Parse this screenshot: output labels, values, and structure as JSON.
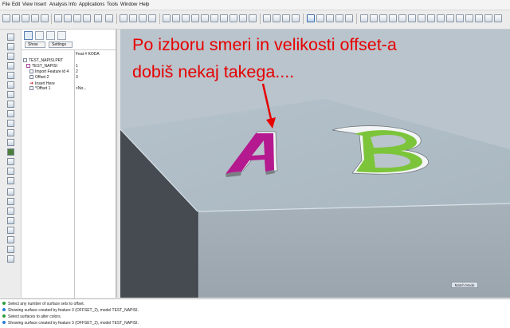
{
  "menubar": {
    "items": [
      "File",
      "Edit",
      "View",
      "Insert",
      "Analysis",
      "Info",
      "Applications",
      "Tools",
      "Window",
      "Help"
    ]
  },
  "navigator": {
    "show_label": "Show",
    "settings_label": "Settings"
  },
  "model_tree": {
    "column_header": "Feat # KODA",
    "rows": [
      {
        "name": "TEST_NAPISI.PRT",
        "value": ""
      },
      {
        "name": "TEST_NAPISI",
        "value": "1"
      },
      {
        "name": "Import Feature id 4",
        "value": "2"
      },
      {
        "name": "Offset 2",
        "value": "3"
      },
      {
        "name": "Insert Here",
        "value": ""
      },
      {
        "name": "*Offset 1",
        "value": "<No..."
      }
    ]
  },
  "annotation": {
    "line1": "Po izboru smeri in velikosti offset-a",
    "line2": "dobiš nekaj takega....",
    "color": "#e60000"
  },
  "model": {
    "letter_a": "A",
    "letter_b": "B",
    "letter_a_color": "#b5198f",
    "letter_b_color": "#7cc43a"
  },
  "viewport": {
    "mode_badge": "Match Mode"
  },
  "messages": [
    {
      "text": "Select any number of surface sets to offset.",
      "color": "#2c9c3a"
    },
    {
      "text": "Showing surface created by feature 3 (OFFSET_2), model TEST_NAPISI.",
      "color": "#2a7fd6"
    },
    {
      "text": "Select surfaces to alter colors.",
      "color": "#2c9c3a"
    },
    {
      "text": "Showing surface created by feature 3 (OFFSET_2), model TEST_NAPISI.",
      "color": "#2a7fd6"
    }
  ]
}
